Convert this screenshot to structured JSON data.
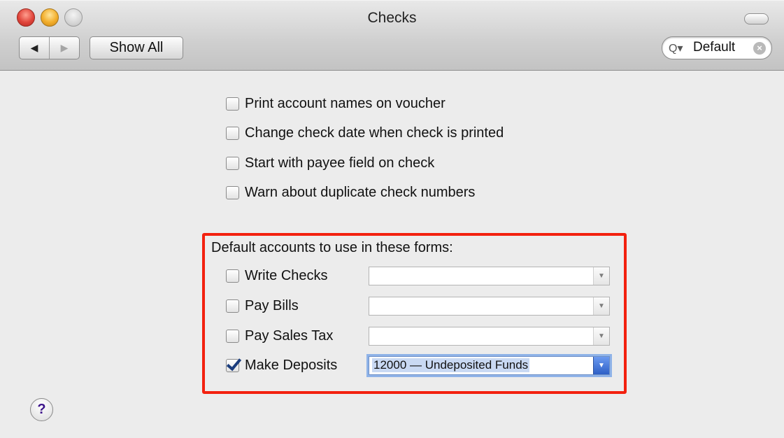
{
  "window": {
    "title": "Checks"
  },
  "toolbar": {
    "back_glyph": "◀",
    "forward_glyph": "▶",
    "show_all_label": "Show All",
    "search_value": "Default",
    "search_icon": "Q▾",
    "clear_glyph": "×"
  },
  "options": [
    {
      "label": "Print account names on voucher",
      "checked": false
    },
    {
      "label": "Change check date when check is printed",
      "checked": false
    },
    {
      "label": "Start with payee field on check",
      "checked": false
    },
    {
      "label": "Warn about duplicate check numbers",
      "checked": false
    }
  ],
  "defaults": {
    "heading": "Default accounts to use in these forms:",
    "rows": [
      {
        "label": "Write Checks",
        "checked": false,
        "value": ""
      },
      {
        "label": "Pay Bills",
        "checked": false,
        "value": ""
      },
      {
        "label": "Pay Sales Tax",
        "checked": false,
        "value": ""
      },
      {
        "label": "Make Deposits",
        "checked": true,
        "value": "12000 — Undeposited Funds"
      }
    ]
  },
  "help": {
    "glyph": "?"
  },
  "colors": {
    "highlight": "#f3210f",
    "focus": "#8fb3e8"
  }
}
